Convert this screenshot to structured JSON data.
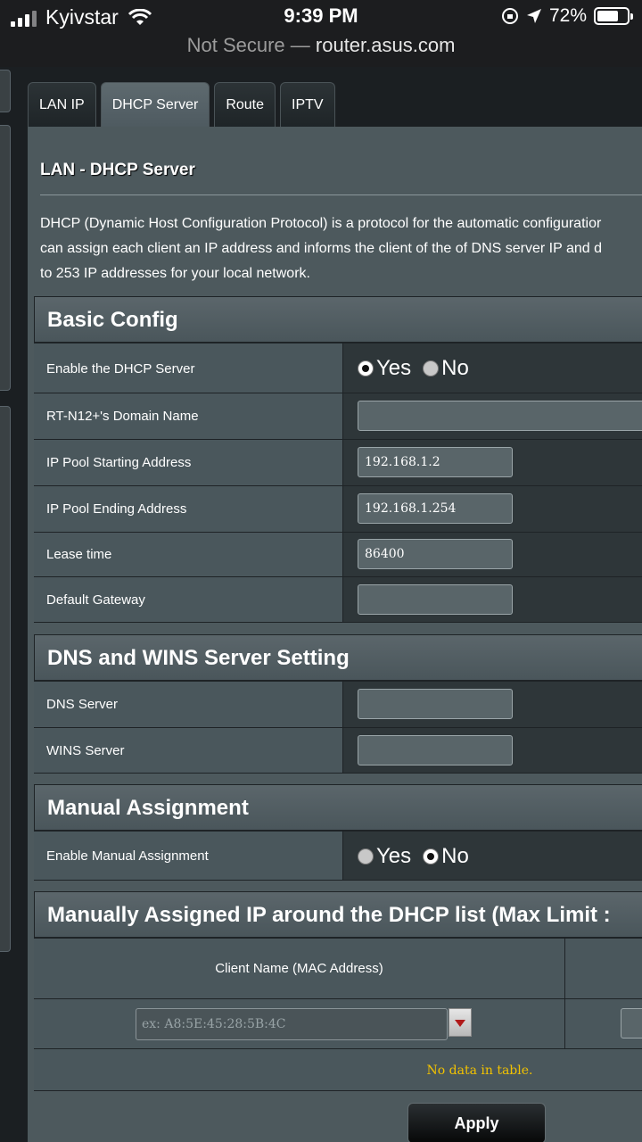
{
  "status": {
    "carrier": "Kyivstar",
    "time": "9:39 PM",
    "battery": "72%",
    "battery_level": 0.72
  },
  "url": {
    "security": "Not Secure —",
    "host": "router.asus.com"
  },
  "tabs": [
    {
      "label": "LAN IP"
    },
    {
      "label": "DHCP Server"
    },
    {
      "label": "Route"
    },
    {
      "label": "IPTV"
    }
  ],
  "page": {
    "title": "LAN - DHCP Server",
    "description_lines": [
      "DHCP (Dynamic Host Configuration Protocol) is a protocol for the automatic configuratior",
      "can assign each client an IP address and informs the client of the of DNS server IP and d",
      "to 253 IP addresses for your local network."
    ]
  },
  "basic": {
    "title": "Basic Config",
    "enable_label": "Enable the DHCP Server",
    "yes": "Yes",
    "no": "No",
    "domain_label": "RT-N12+'s Domain Name",
    "domain_value": "",
    "start_label": "IP Pool Starting Address",
    "start_value": "192.168.1.2",
    "end_label": "IP Pool Ending Address",
    "end_value": "192.168.1.254",
    "lease_label": "Lease time",
    "lease_value": "86400",
    "gateway_label": "Default Gateway",
    "gateway_value": ""
  },
  "dns": {
    "title": "DNS and WINS Server Setting",
    "dns_label": "DNS Server",
    "dns_value": "",
    "wins_label": "WINS Server",
    "wins_value": ""
  },
  "manual": {
    "title": "Manual Assignment",
    "enable_label": "Enable Manual Assignment",
    "yes": "Yes",
    "no": "No"
  },
  "list": {
    "title": "Manually Assigned IP around the DHCP list (Max Limit :",
    "col_client": "Client Name (MAC Address)",
    "mac_placeholder": "ex: A8:5E:45:28:5B:4C",
    "empty": "No data in table."
  },
  "apply_label": "Apply"
}
